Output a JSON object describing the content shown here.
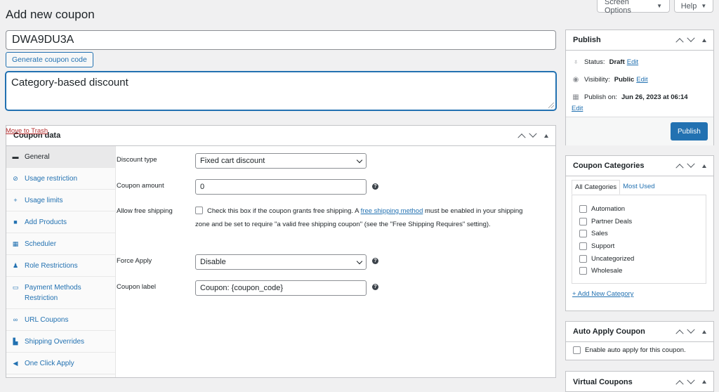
{
  "header": {
    "page_title": "Add new coupon",
    "screen_options": "Screen Options",
    "help": "Help"
  },
  "coupon": {
    "code": "DWA9DU3A",
    "generate_label": "Generate coupon code",
    "description": "Category-based discount"
  },
  "coupon_data": {
    "title": "Coupon data",
    "tabs": [
      {
        "label": "General",
        "icon": "wrench-icon"
      },
      {
        "label": "Usage restriction",
        "icon": "block-icon"
      },
      {
        "label": "Usage limits",
        "icon": "plus-icon"
      },
      {
        "label": "Add Products",
        "icon": "bag-icon"
      },
      {
        "label": "Scheduler",
        "icon": "calendar-icon"
      },
      {
        "label": "Role Restrictions",
        "icon": "user-icon"
      },
      {
        "label": "Payment Methods Restriction",
        "icon": "card-icon"
      },
      {
        "label": "URL Coupons",
        "icon": "link-icon"
      },
      {
        "label": "Shipping Overrides",
        "icon": "truck-icon"
      },
      {
        "label": "One Click Apply",
        "icon": "megaphone-icon"
      }
    ],
    "fields": {
      "discount_type_label": "Discount type",
      "discount_type_value": "Fixed cart discount",
      "coupon_amount_label": "Coupon amount",
      "coupon_amount_value": "0",
      "free_shipping_label": "Allow free shipping",
      "free_shipping_text_1": "Check this box if the coupon grants free shipping. A ",
      "free_shipping_link": "free shipping method",
      "free_shipping_text_2": " must be enabled in your shipping zone and be set to require \"a valid free shipping coupon\" (see the \"Free Shipping Requires\" setting).",
      "force_apply_label": "Force Apply",
      "force_apply_value": "Disable",
      "coupon_label_label": "Coupon label",
      "coupon_label_value": "Coupon: {coupon_code}"
    }
  },
  "publish": {
    "title": "Publish",
    "status_label": "Status:",
    "status_value": "Draft",
    "visibility_label": "Visibility:",
    "visibility_value": "Public",
    "publish_on_label": "Publish on:",
    "publish_on_value": "Jun 26, 2023 at 06:14",
    "edit": "Edit",
    "move_to_trash": "Move to Trash",
    "publish_button": "Publish"
  },
  "categories": {
    "title": "Coupon Categories",
    "tab_all": "All Categories",
    "tab_most_used": "Most Used",
    "items": [
      "Automation",
      "Partner Deals",
      "Sales",
      "Support",
      "Uncategorized",
      "Wholesale"
    ],
    "add_new": "+ Add New Category"
  },
  "auto_apply": {
    "title": "Auto Apply Coupon",
    "checkbox_label": "Enable auto apply for this coupon."
  },
  "virtual": {
    "title": "Virtual Coupons"
  }
}
